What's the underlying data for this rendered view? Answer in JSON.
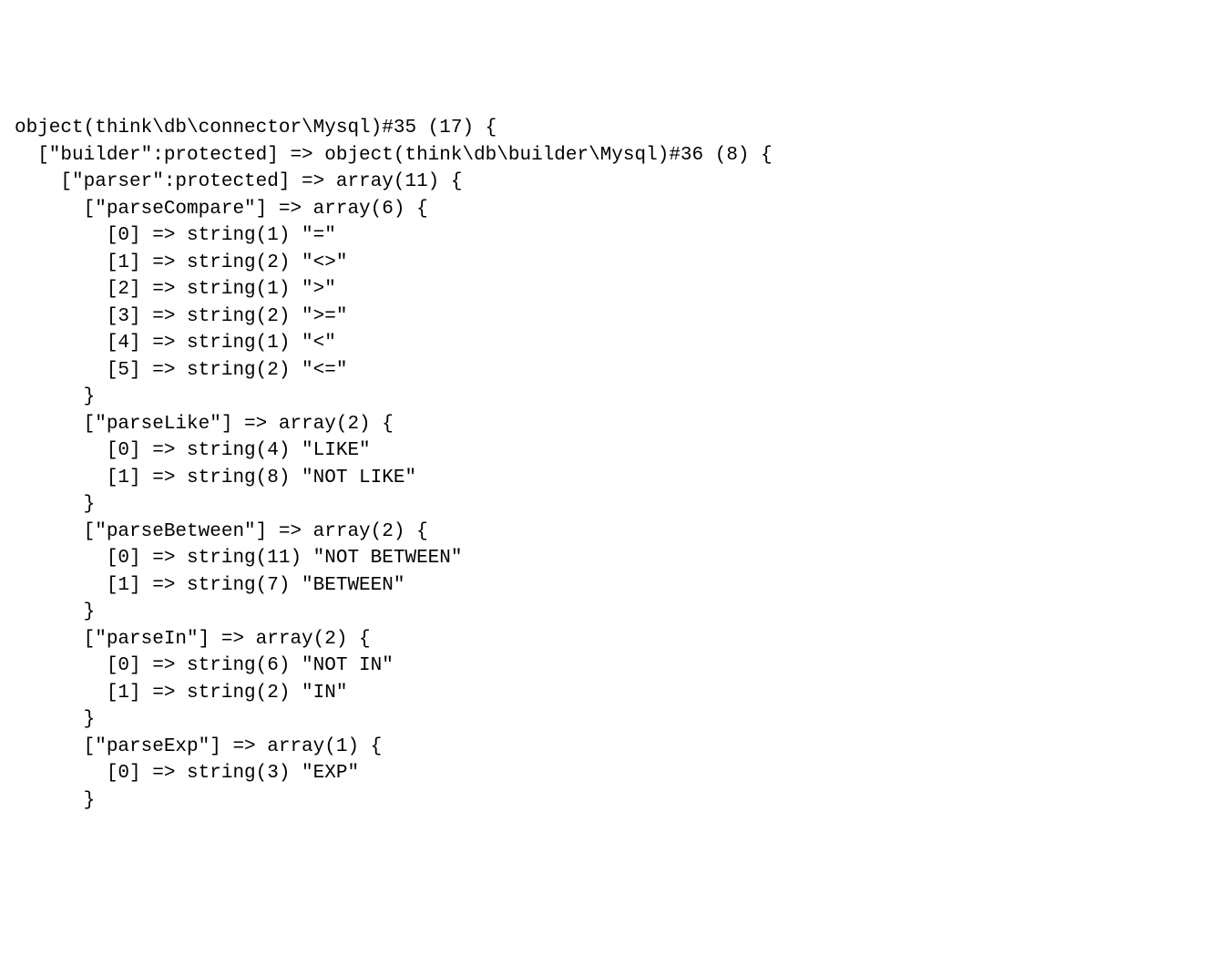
{
  "dump": {
    "line1": "object(think\\db\\connector\\Mysql)#35 (17) {",
    "line2": "  [\"builder\":protected] => object(think\\db\\builder\\Mysql)#36 (8) {",
    "line3": "    [\"parser\":protected] => array(11) {",
    "line4": "      [\"parseCompare\"] => array(6) {",
    "line5": "        [0] => string(1) \"=\"",
    "line6": "        [1] => string(2) \"<>\"",
    "line7": "        [2] => string(1) \">\"",
    "line8": "        [3] => string(2) \">=\"",
    "line9": "        [4] => string(1) \"<\"",
    "line10": "        [5] => string(2) \"<=\"",
    "line11": "      }",
    "line12": "      [\"parseLike\"] => array(2) {",
    "line13": "        [0] => string(4) \"LIKE\"",
    "line14": "        [1] => string(8) \"NOT LIKE\"",
    "line15": "      }",
    "line16": "      [\"parseBetween\"] => array(2) {",
    "line17": "        [0] => string(11) \"NOT BETWEEN\"",
    "line18": "        [1] => string(7) \"BETWEEN\"",
    "line19": "      }",
    "line20": "      [\"parseIn\"] => array(2) {",
    "line21": "        [0] => string(6) \"NOT IN\"",
    "line22": "        [1] => string(2) \"IN\"",
    "line23": "      }",
    "line24": "      [\"parseExp\"] => array(1) {",
    "line25": "        [0] => string(3) \"EXP\"",
    "line26": "      }"
  }
}
